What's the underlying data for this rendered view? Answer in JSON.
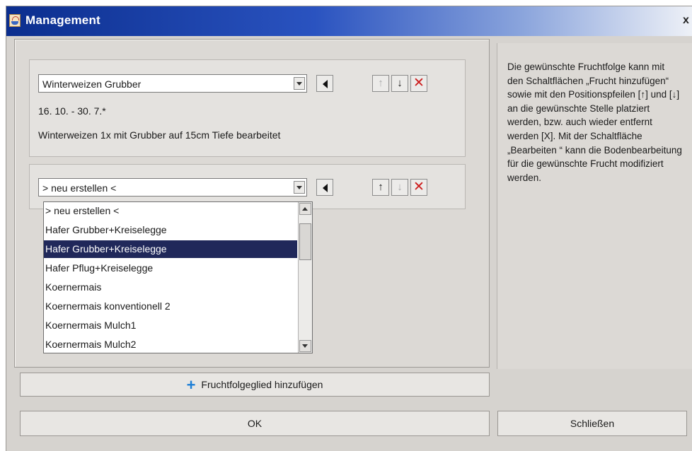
{
  "window": {
    "title": "Management",
    "close_glyph": "x"
  },
  "rotation": {
    "members": [
      {
        "crop_value": "Winterweizen Grubber",
        "dates": "16. 10. - 30. 7.*",
        "description": "Winterweizen 1x mit Grubber auf 15cm Tiefe bearbeitet",
        "buttons": {
          "edit": "◀",
          "up": "↑",
          "down": "↓",
          "remove": "✕"
        },
        "up_enabled": false,
        "down_enabled": true
      },
      {
        "crop_value": "> neu erstellen <",
        "buttons": {
          "edit": "◀",
          "up": "↑",
          "down": "↓",
          "remove": "✕"
        },
        "up_enabled": true,
        "down_enabled": false
      }
    ],
    "dropdown": {
      "options": [
        "> neu erstellen <",
        "Hafer Grubber+Kreiselegge",
        "Hafer Grubber+Kreiselegge",
        "Hafer Pflug+Kreiselegge",
        "Koernermais",
        "Koernermais konventionell 2",
        "Koernermais Mulch1",
        "Koernermais Mulch2"
      ],
      "highlighted_index": 2
    }
  },
  "buttons": {
    "add_label": "Fruchtfolgeglied hinzufügen",
    "add_icon": "+",
    "ok_label": "OK",
    "close_label": "Schließen"
  },
  "help": {
    "text": "Die gewünschte Fruchtfolge kann mit den Schaltflächen „Frucht hinzufügen“ sowie mit den Positionspfeilen [↑] und [↓] an die gewünschte Stelle platziert werden, bzw. auch wieder entfernt werden [X]. Mit der Schaltfläche „Bearbeiten “ kann die Bodenbearbeitung für die gewünschte Frucht modifiziert werden."
  },
  "colors": {
    "titlebar_start": "#0b2e8e",
    "selection": "#20285a",
    "remove_red": "#cc1b1b",
    "add_blue": "#1d7fd6"
  }
}
